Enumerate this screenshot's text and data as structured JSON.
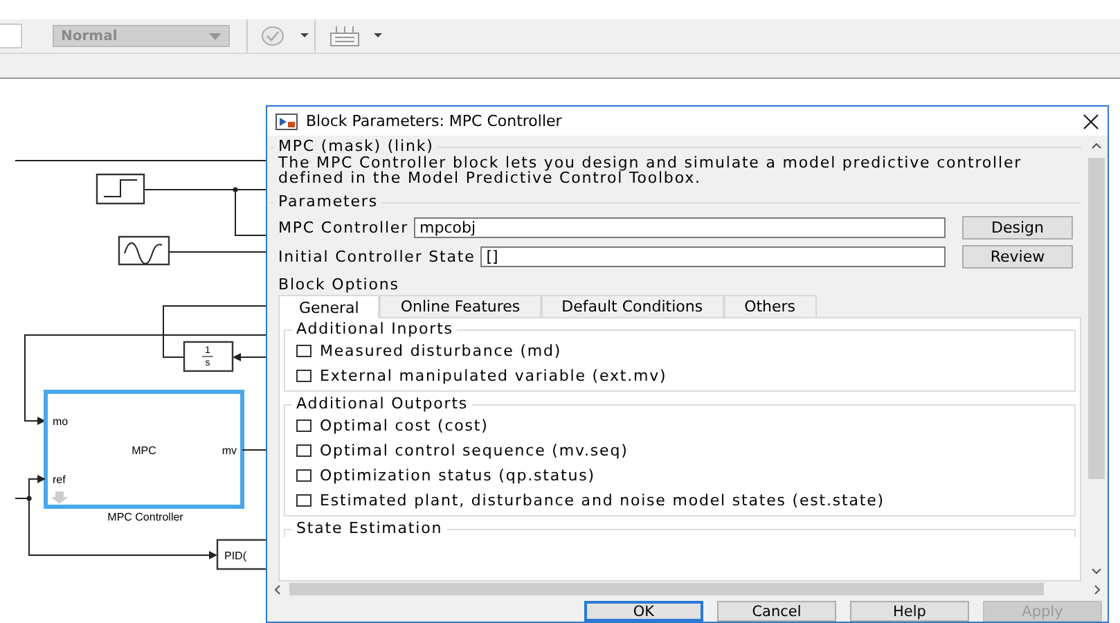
{
  "toolbar": {
    "style_dropdown": {
      "value": "Normal",
      "disabled": true
    }
  },
  "diagram": {
    "mpc_block": {
      "title": "MPC",
      "input_ports": [
        "mo",
        "ref"
      ],
      "output_port": "mv",
      "caption": "MPC Controller",
      "selected": true
    },
    "integrator": {
      "numerator": "1",
      "denominator": "s"
    },
    "pid_block": {
      "label": "PID("
    }
  },
  "dialog": {
    "title": "Block Parameters: MPC Controller",
    "mask": {
      "heading": "MPC (mask) (link)",
      "description": "The MPC Controller block lets you design and simulate a model predictive controller defined in the Model Predictive Control Toolbox."
    },
    "parameters": {
      "heading": "Parameters",
      "fields": [
        {
          "label": "MPC Controller",
          "value": "mpcobj",
          "button": "Design"
        },
        {
          "label": "Initial Controller State",
          "value": "[]",
          "button": "Review"
        }
      ]
    },
    "block_options": {
      "heading": "Block Options",
      "tabs": [
        {
          "label": "General",
          "selected": true
        },
        {
          "label": "Online Features",
          "selected": false
        },
        {
          "label": "Default Conditions",
          "selected": false
        },
        {
          "label": "Others",
          "selected": false
        }
      ],
      "groups": [
        {
          "heading": "Additional Inports",
          "options": [
            {
              "label": "Measured disturbance (md)",
              "checked": false
            },
            {
              "label": "External manipulated variable (ext.mv)",
              "checked": false
            }
          ]
        },
        {
          "heading": "Additional Outports",
          "options": [
            {
              "label": "Optimal cost (cost)",
              "checked": false
            },
            {
              "label": "Optimal control sequence (mv.seq)",
              "checked": false
            },
            {
              "label": "Optimization status (qp.status)",
              "checked": false
            },
            {
              "label": "Estimated plant, disturbance and noise model states (est.state)",
              "checked": false
            }
          ]
        }
      ],
      "next_group": "State Estimation"
    },
    "buttons": [
      {
        "label": "OK",
        "default": true,
        "disabled": false
      },
      {
        "label": "Cancel",
        "default": false,
        "disabled": false
      },
      {
        "label": "Help",
        "default": false,
        "disabled": false
      },
      {
        "label": "Apply",
        "default": false,
        "disabled": true
      }
    ]
  }
}
